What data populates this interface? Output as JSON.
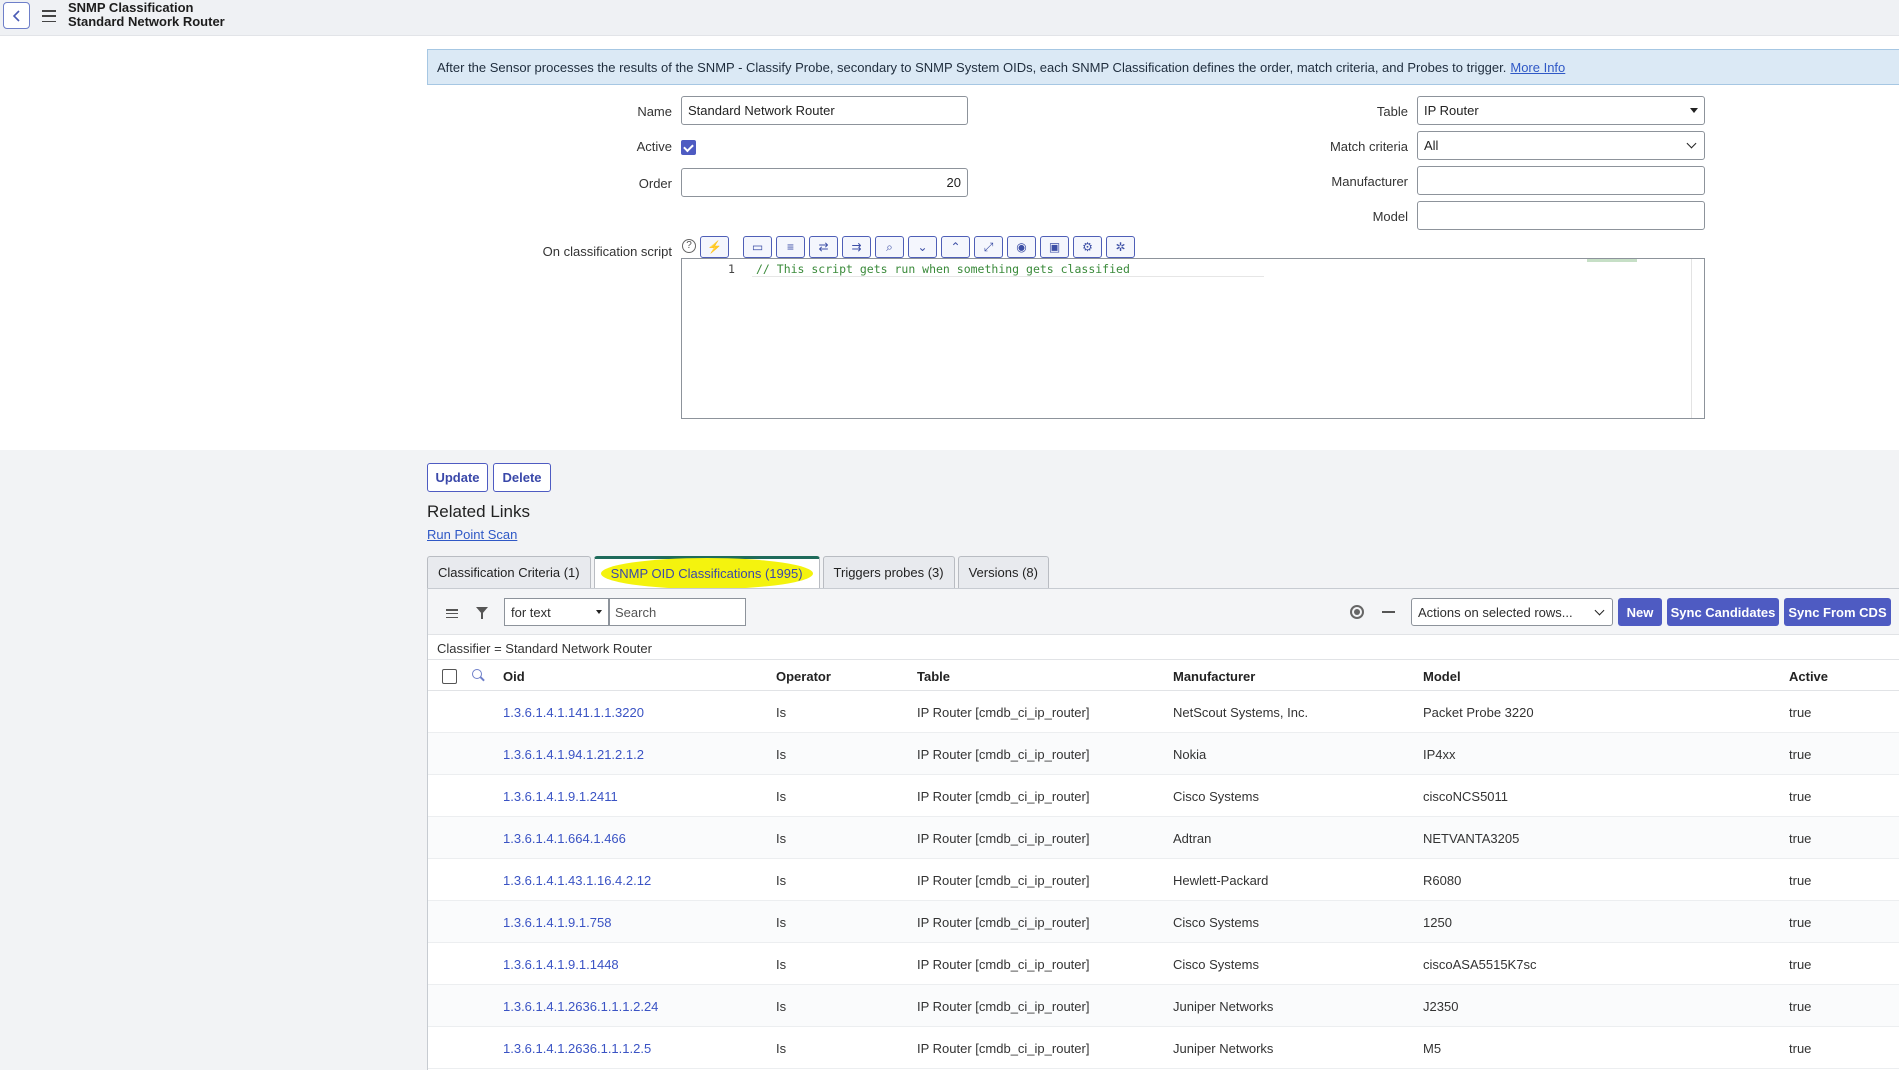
{
  "header": {
    "title_line1": "SNMP Classification",
    "title_line2": "Standard Network Router"
  },
  "banner": {
    "text": "After the Sensor processes the results of the SNMP - Classify Probe, secondary to SNMP System OIDs, each SNMP Classification defines the order, match criteria, and Probes to trigger.",
    "link": "More Info"
  },
  "form": {
    "name_label": "Name",
    "name_value": "Standard Network Router",
    "active_label": "Active",
    "active_checked": true,
    "order_label": "Order",
    "order_value": "20",
    "script_label": "On classification script",
    "table_label": "Table",
    "table_value": "IP Router",
    "match_label": "Match criteria",
    "match_value": "All",
    "manufacturer_label": "Manufacturer",
    "manufacturer_value": "",
    "model_label": "Model",
    "model_value": ""
  },
  "editor": {
    "line_number": "1",
    "code": "// This script gets run when something gets classified"
  },
  "buttons": {
    "update": "Update",
    "delete": "Delete"
  },
  "related": {
    "title": "Related Links",
    "link": "Run Point Scan"
  },
  "tabs": [
    {
      "label": "Classification Criteria (1)"
    },
    {
      "label": "SNMP OID Classifications (1995)"
    },
    {
      "label": "Triggers probes (3)"
    },
    {
      "label": "Versions (8)"
    }
  ],
  "list": {
    "for_text": "for text",
    "search_placeholder": "Search",
    "actions": "Actions on selected rows...",
    "new": "New",
    "sync_candidates": "Sync Candidates",
    "sync_cds": "Sync From CDS",
    "filter": "Classifier = Standard Network Router",
    "columns": [
      "Oid",
      "Operator",
      "Table",
      "Manufacturer",
      "Model",
      "Active"
    ],
    "rows": [
      {
        "oid": "1.3.6.1.4.1.141.1.1.3220",
        "op": "Is",
        "table": "IP Router [cmdb_ci_ip_router]",
        "mfr": "NetScout Systems, Inc.",
        "model": "Packet Probe 3220",
        "active": "true"
      },
      {
        "oid": "1.3.6.1.4.1.94.1.21.2.1.2",
        "op": "Is",
        "table": "IP Router [cmdb_ci_ip_router]",
        "mfr": "Nokia",
        "model": "IP4xx",
        "active": "true"
      },
      {
        "oid": "1.3.6.1.4.1.9.1.2411",
        "op": "Is",
        "table": "IP Router [cmdb_ci_ip_router]",
        "mfr": "Cisco Systems",
        "model": "ciscoNCS5011",
        "active": "true"
      },
      {
        "oid": "1.3.6.1.4.1.664.1.466",
        "op": "Is",
        "table": "IP Router [cmdb_ci_ip_router]",
        "mfr": "Adtran",
        "model": "NETVANTA3205",
        "active": "true"
      },
      {
        "oid": "1.3.6.1.4.1.43.1.16.4.2.12",
        "op": "Is",
        "table": "IP Router [cmdb_ci_ip_router]",
        "mfr": "Hewlett-Packard",
        "model": "R6080",
        "active": "true"
      },
      {
        "oid": "1.3.6.1.4.1.9.1.758",
        "op": "Is",
        "table": "IP Router [cmdb_ci_ip_router]",
        "mfr": "Cisco Systems",
        "model": "1250",
        "active": "true"
      },
      {
        "oid": "1.3.6.1.4.1.9.1.1448",
        "op": "Is",
        "table": "IP Router [cmdb_ci_ip_router]",
        "mfr": "Cisco Systems",
        "model": "ciscoASA5515K7sc",
        "active": "true"
      },
      {
        "oid": "1.3.6.1.4.1.2636.1.1.1.2.24",
        "op": "Is",
        "table": "IP Router [cmdb_ci_ip_router]",
        "mfr": "Juniper Networks",
        "model": "J2350",
        "active": "true"
      },
      {
        "oid": "1.3.6.1.4.1.2636.1.1.1.2.5",
        "op": "Is",
        "table": "IP Router [cmdb_ci_ip_router]",
        "mfr": "Juniper Networks",
        "model": "M5",
        "active": "true"
      }
    ]
  }
}
